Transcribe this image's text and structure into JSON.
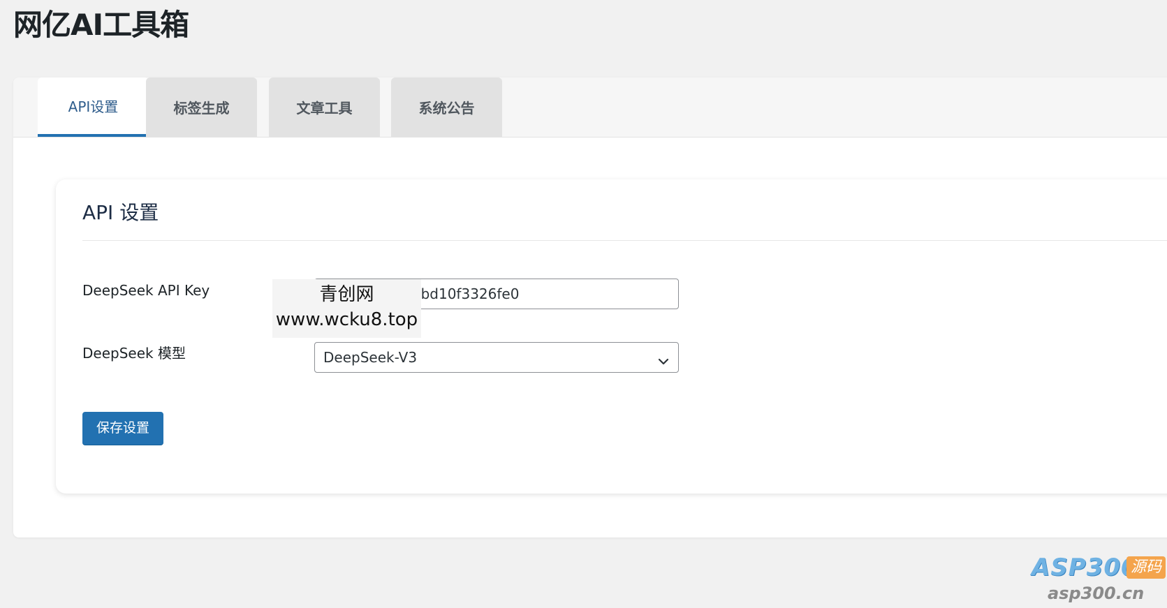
{
  "page": {
    "title": "网亿AI工具箱"
  },
  "tabs": [
    {
      "label": "API设置",
      "active": true
    },
    {
      "label": "标签生成",
      "active": false
    },
    {
      "label": "文章工具",
      "active": false
    },
    {
      "label": "系统公告",
      "active": false
    }
  ],
  "card": {
    "title": "API 设置",
    "api_key_label": "DeepSeek API Key",
    "api_key_value": "04aa68562bd10f3326fe0",
    "model_label": "DeepSeek 模型",
    "model_value": "DeepSeek-V3",
    "save_label": "保存设置"
  },
  "watermark": {
    "line1": "青创网",
    "line2": "www.wcku8.top"
  },
  "logo": {
    "brand": "ASP300",
    "badge": "源码",
    "domain": "asp300.cn"
  },
  "icons": {
    "select_arrow": "chevron-down-icon"
  },
  "colors": {
    "primary": "#2271b1",
    "active_tab_text": "#2f5d8c",
    "page_bg": "#f1f1f1",
    "inactive_tab_bg": "#e2e2e2"
  }
}
